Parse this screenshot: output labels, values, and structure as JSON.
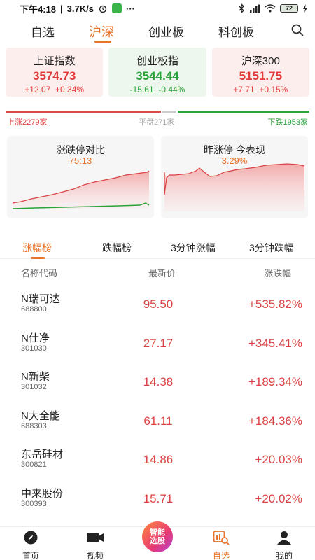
{
  "status_bar": {
    "time": "下午4:18",
    "speed": "3.7K/s",
    "battery": "72"
  },
  "top_nav": {
    "tabs": [
      {
        "label": "自选"
      },
      {
        "label": "沪深"
      },
      {
        "label": "创业板"
      },
      {
        "label": "科创板"
      }
    ],
    "active_tab": "沪深"
  },
  "indices": [
    {
      "name": "上证指数",
      "value": "3574.73",
      "change": "+12.07",
      "pct": "+0.34%",
      "trend": "up"
    },
    {
      "name": "创业板指",
      "value": "3544.44",
      "change": "-15.61",
      "pct": "-0.44%",
      "trend": "down"
    },
    {
      "name": "沪深300",
      "value": "5151.75",
      "change": "+7.71",
      "pct": "+0.15%",
      "trend": "up"
    }
  ],
  "breadth": {
    "up_label": "上涨2279家",
    "flat_label": "平盘271家",
    "down_label": "下跌1953家",
    "up": 2279,
    "flat": 271,
    "down": 1953
  },
  "charts": {
    "limit_compare": {
      "title": "涨跌停对比",
      "value": "75:13"
    },
    "yesterday_limit": {
      "title": "昨涨停 今表现",
      "value": "3.29%"
    }
  },
  "rank_tabs": [
    {
      "label": "涨幅榜"
    },
    {
      "label": "跌幅榜"
    },
    {
      "label": "3分钟涨幅"
    },
    {
      "label": "3分钟跌幅"
    }
  ],
  "list_header": {
    "name": "名称代码",
    "price": "最新价",
    "change": "涨跌幅"
  },
  "stocks": [
    {
      "name": "N瑞可达",
      "code": "688800",
      "price": "95.50",
      "change": "+535.82%"
    },
    {
      "name": "N仕净",
      "code": "301030",
      "price": "27.17",
      "change": "+345.41%"
    },
    {
      "name": "N新柴",
      "code": "301032",
      "price": "14.38",
      "change": "+189.34%"
    },
    {
      "name": "N大全能",
      "code": "688303",
      "price": "61.11",
      "change": "+184.36%"
    },
    {
      "name": "东岳硅材",
      "code": "300821",
      "price": "14.86",
      "change": "+20.03%"
    },
    {
      "name": "中来股份",
      "code": "300393",
      "price": "15.71",
      "change": "+20.02%"
    }
  ],
  "bottom_nav": {
    "home": "首页",
    "video": "视频",
    "ai": "智能选股",
    "watchlist": "自选",
    "me": "我的",
    "active": "自选"
  },
  "colors": {
    "accent": "#e8742b",
    "up": "#e03b3b",
    "down": "#2aa33a"
  }
}
